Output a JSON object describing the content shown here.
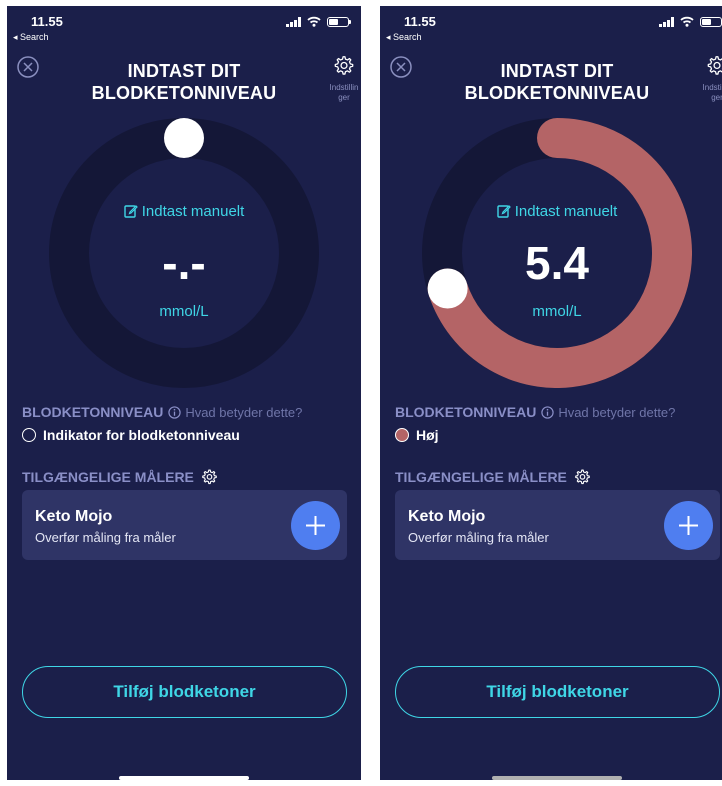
{
  "colors": {
    "background": "#1b1f4a",
    "ring_track": "#141737",
    "ring_high": "#b46466",
    "accent_cyan": "#3fd6e6",
    "add_button": "#4f7ef0",
    "card": "#2f3466"
  },
  "screens": [
    {
      "status": {
        "time": "11.55",
        "back": "◂ Search"
      },
      "title_line1": "INDTAST DIT",
      "title_line2": "BLODKETONNIVEAU",
      "settings_label_1": "Indstillin",
      "settings_label_2": "ger",
      "gauge": {
        "manual_label": "Indtast manuelt",
        "value": "-.-",
        "unit": "mmol/L",
        "fill_fraction": 0
      },
      "level_label": "BLODKETONNIVEAU",
      "info_link": "Hvad betyder dette?",
      "indicator_text": "Indikator for blodketonniveau",
      "indicator_color": "transparent",
      "meters_label": "TILGÆNGELIGE MÅLERE",
      "meter": {
        "name": "Keto Mojo",
        "subtitle": "Overfør måling fra måler"
      },
      "cta": "Tilføj blodketoner",
      "home_indicator_color": "#ffffff"
    },
    {
      "status": {
        "time": "11.55",
        "back": "◂ Search"
      },
      "title_line1": "INDTAST DIT",
      "title_line2": "BLODKETONNIVEAU",
      "settings_label_1": "Indstillin",
      "settings_label_2": "ger",
      "gauge": {
        "manual_label": "Indtast manuelt",
        "value": "5.4",
        "unit": "mmol/L",
        "fill_fraction": 0.7
      },
      "level_label": "BLODKETONNIVEAU",
      "info_link": "Hvad betyder dette?",
      "indicator_text": "Høj",
      "indicator_color": "#b46466",
      "meters_label": "TILGÆNGELIGE MÅLERE",
      "meter": {
        "name": "Keto Mojo",
        "subtitle": "Overfør måling fra måler"
      },
      "cta": "Tilføj blodketoner",
      "home_indicator_color": "#b0b0b0"
    }
  ]
}
